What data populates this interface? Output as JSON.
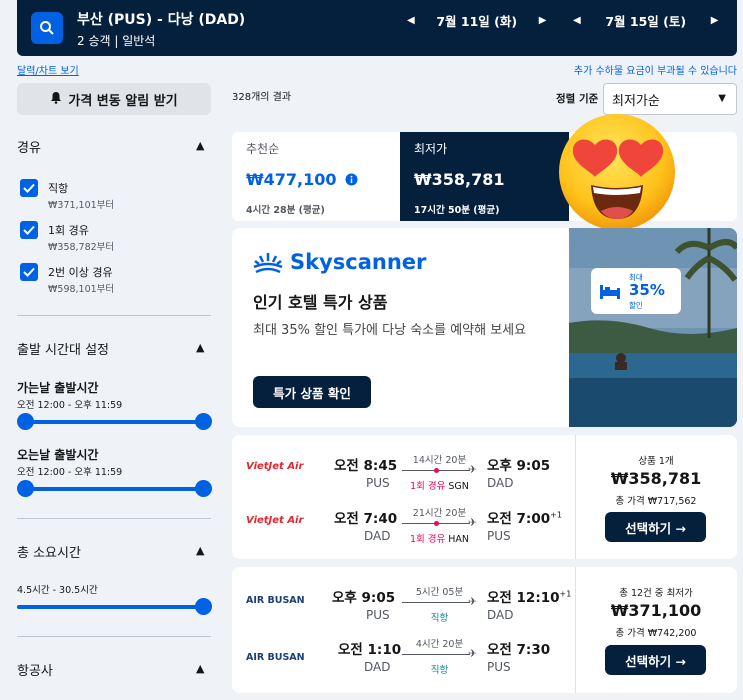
{
  "header": {
    "route": "부산 (PUS) - 다낭 (DAD)",
    "passengers": "2 승객",
    "cabin": "일반석",
    "depart_date": "7월 11일 (화)",
    "return_date": "7월 15일 (토)"
  },
  "links": {
    "calendar": "달력/차트 보기",
    "baggage_note": "추가 수하물 요금이 부과될 수 있습니다"
  },
  "sidebar": {
    "price_alert": "가격 변동 알림 받기",
    "stops_title": "경유",
    "stops": [
      {
        "label": "직항",
        "price": "₩371,101부터"
      },
      {
        "label": "1회 경유",
        "price": "₩358,782부터"
      },
      {
        "label": "2번 이상 경유",
        "price": "₩598,101부터"
      }
    ],
    "departure_title": "출발 시간대 설정",
    "outbound_title": "가는날 출발시간",
    "outbound_range": "오전 12:00 - 오후 11:59",
    "return_title": "오는날 출발시간",
    "return_range": "오전 12:00 - 오후 11:59",
    "duration_title": "총 소요시간",
    "duration_range": "4.5시간 - 30.5시간",
    "airline_title": "항공사"
  },
  "results": {
    "count": "328개의 결과",
    "sort_label": "정렬 기준",
    "sort_value": "최저가순"
  },
  "tabs": [
    {
      "name": "추천순",
      "price": "₩477,100",
      "duration": "4시간 28분 (평균)"
    },
    {
      "name": "최저가",
      "price": "₩358,781",
      "duration": "17시간 50분 (평균)"
    }
  ],
  "ad": {
    "brand": "Skyscanner",
    "title": "인기 호텔 특가 상품",
    "description": "최대 35% 할인 특가에 다낭 숙소를 예약해 보세요",
    "button": "특가 상품 확인",
    "badge_top": "최대",
    "badge_pct": "35%",
    "badge_bottom": "할인"
  },
  "flights": [
    {
      "airline": "VietJet Air",
      "legs": [
        {
          "dep_time": "오전 8:45",
          "dep_code": "PUS",
          "duration": "14시간 20분",
          "stops": "1회 경유",
          "via": "SGN",
          "arr_time": "오후 9:05",
          "arr_code": "DAD",
          "plus": ""
        },
        {
          "dep_time": "오전 7:40",
          "dep_code": "DAD",
          "duration": "21시간 20분",
          "stops": "1회 경유",
          "via": "HAN",
          "arr_time": "오전 7:00",
          "arr_code": "PUS",
          "plus": "+1"
        }
      ],
      "deal_label": "상품 1개",
      "price": "₩358,781",
      "total": "총 가격 ₩717,562",
      "button": "선택하기 →"
    },
    {
      "airline": "AIR BUSAN",
      "legs": [
        {
          "dep_time": "오후 9:05",
          "dep_code": "PUS",
          "duration": "5시간 05분",
          "stops": "직항",
          "via": "",
          "arr_time": "오전 12:10",
          "arr_code": "DAD",
          "plus": "+1"
        },
        {
          "dep_time": "오전 1:10",
          "dep_code": "DAD",
          "duration": "4시간 20분",
          "stops": "직항",
          "via": "",
          "arr_time": "오전 7:30",
          "arr_code": "PUS",
          "plus": ""
        }
      ],
      "deal_label": "총 12건 중 최저가",
      "price": "₩371,100",
      "total": "총 가격 ₩742,200",
      "button": "선택하기 →"
    }
  ],
  "colors": {
    "navy": "#05203c",
    "blue": "#0062e3",
    "stop": "#e70866",
    "direct": "#0c838a"
  }
}
